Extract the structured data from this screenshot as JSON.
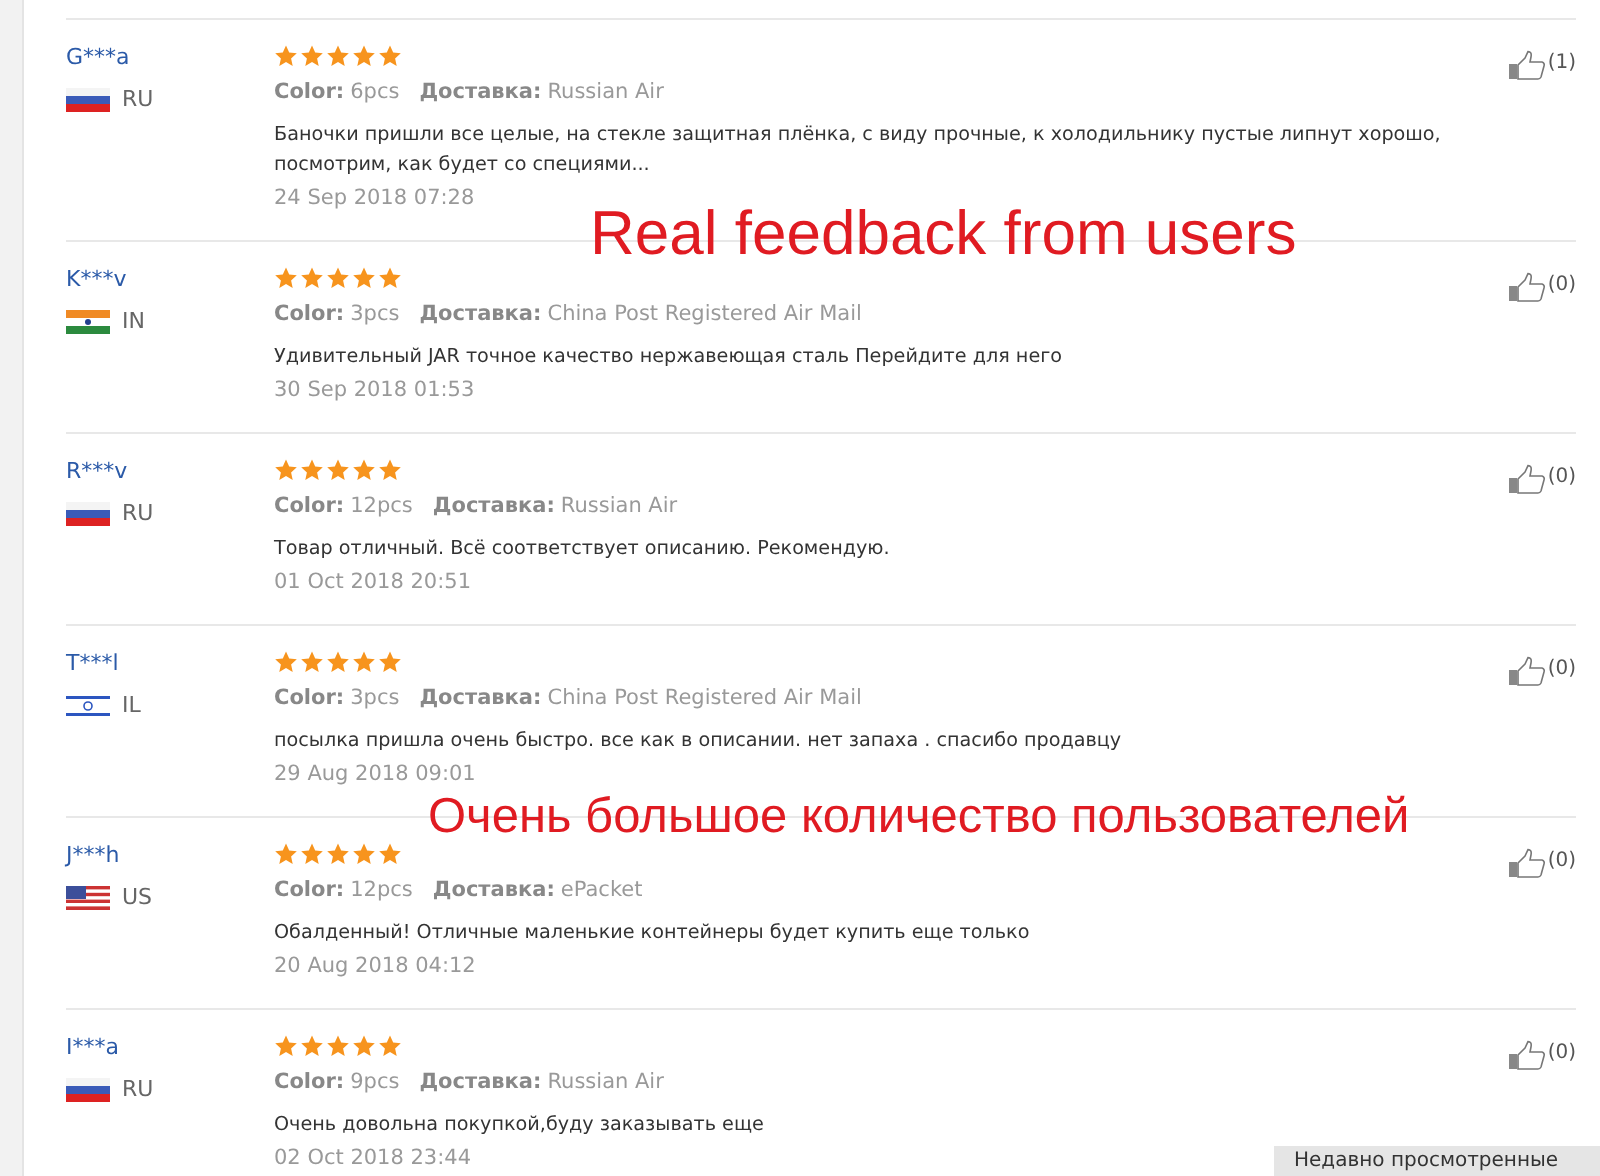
{
  "reviews": [
    {
      "user": "G***a",
      "flag": {
        "kind": "ru"
      },
      "country": "RU",
      "stars": 5,
      "color_label": "Color:",
      "color_value": "6pcs",
      "delivery_label": "Доставка:",
      "delivery_value": "Russian Air",
      "text": "Баночки пришли все целые, на стекле защитная плёнка, с виду прочные, к холодильнику пустые липнут хорошо, посмотрим, как будет со специями...",
      "date": "24 Sep 2018 07:28",
      "likes": "(1)"
    },
    {
      "user": "K***v",
      "flag": {
        "kind": "in"
      },
      "country": "IN",
      "stars": 5,
      "color_label": "Color:",
      "color_value": "3pcs",
      "delivery_label": "Доставка:",
      "delivery_value": "China Post Registered Air Mail",
      "text": "Удивительный JAR точное качество нержавеющая сталь Перейдите для него",
      "date": "30 Sep 2018 01:53",
      "likes": "(0)"
    },
    {
      "user": "R***v",
      "flag": {
        "kind": "ru"
      },
      "country": "RU",
      "stars": 5,
      "color_label": "Color:",
      "color_value": "12pcs",
      "delivery_label": "Доставка:",
      "delivery_value": "Russian Air",
      "text": "Товар отличный. Всё соответствует описанию. Рекомендую.",
      "date": "01 Oct 2018 20:51",
      "likes": "(0)"
    },
    {
      "user": "T***l",
      "flag": {
        "kind": "il"
      },
      "country": "IL",
      "stars": 5,
      "color_label": "Color:",
      "color_value": "3pcs",
      "delivery_label": "Доставка:",
      "delivery_value": "China Post Registered Air Mail",
      "text": "посылка пришла очень быстро. все как в описании. нет запаха . спасибо продавцу",
      "date": "29 Aug 2018 09:01",
      "likes": "(0)"
    },
    {
      "user": "J***h",
      "flag": {
        "kind": "us"
      },
      "country": "US",
      "stars": 5,
      "color_label": "Color:",
      "color_value": "12pcs",
      "delivery_label": "Доставка:",
      "delivery_value": "ePacket",
      "text": "Обалденный! Отличные маленькие контейнеры будет купить еще только",
      "date": "20 Aug 2018 04:12",
      "likes": "(0)"
    },
    {
      "user": "I***a",
      "flag": {
        "kind": "ru"
      },
      "country": "RU",
      "stars": 5,
      "color_label": "Color:",
      "color_value": "9pcs",
      "delivery_label": "Доставка:",
      "delivery_value": "Russian Air",
      "text": "Очень довольна покупкой,буду заказывать еще",
      "date": "02 Oct 2018 23:44",
      "likes": "(0)"
    }
  ],
  "overlay_captions": [
    "Real feedback from users",
    "Очень большое количество пользователей"
  ],
  "recently_viewed_tab": "Недавно просмотренные"
}
